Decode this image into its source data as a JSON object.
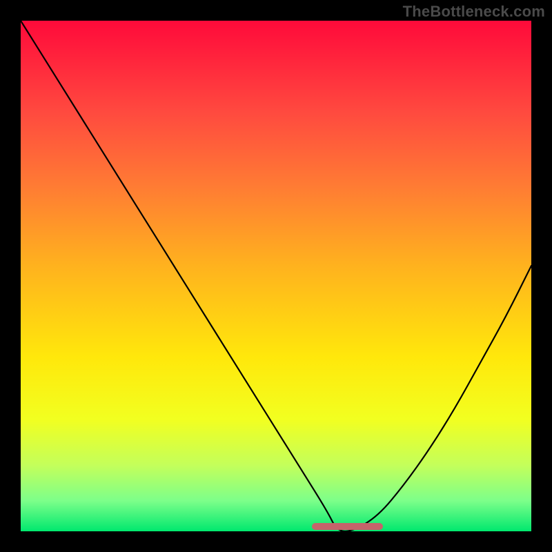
{
  "watermark": "TheBottleneck.com",
  "colors": {
    "frame": "#000000",
    "watermark": "#4a4a4a",
    "curve": "#000000",
    "marker": "#c5636a",
    "gradient_stops": [
      "#ff0a3a",
      "#ff1f3c",
      "#ff4a3f",
      "#ff7a34",
      "#ffb21e",
      "#ffe80b",
      "#f2ff20",
      "#c4ff5a",
      "#7dff8a",
      "#00e86e"
    ]
  },
  "chart_data": {
    "type": "line",
    "x": [
      0,
      5,
      10,
      15,
      20,
      25,
      30,
      35,
      40,
      45,
      50,
      55,
      60,
      62,
      65,
      70,
      75,
      80,
      85,
      90,
      95,
      100
    ],
    "y": [
      100,
      92,
      84,
      76,
      68,
      60,
      52,
      44,
      36,
      28,
      20,
      12,
      4,
      0,
      0,
      3,
      9,
      16,
      24,
      33,
      42,
      52
    ],
    "ylim": [
      0,
      100
    ],
    "xlim": [
      0,
      100
    ],
    "title": "",
    "xlabel": "",
    "ylabel": "",
    "marker_range_x": [
      57,
      71
    ],
    "curve_minimum_x": 63,
    "notes": "V-shaped bottleneck curve; color gradient encodes value from red (high) to green (low). Values estimated from pixel positions."
  }
}
